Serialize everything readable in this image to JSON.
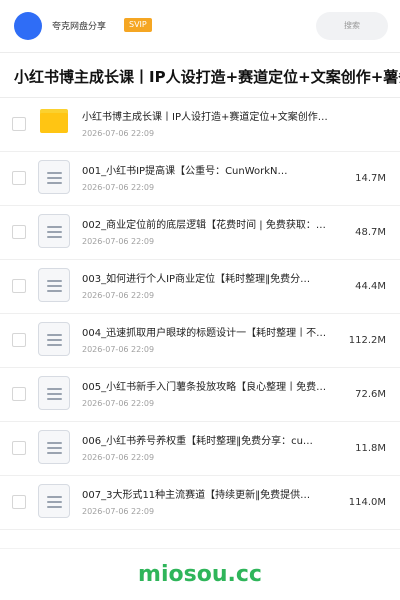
{
  "header": {
    "username": "夸克网盘分享",
    "badge": "SVIP",
    "search_placeholder": "搜索",
    "accent_color": "#2f6df6",
    "badge_color": "#f5a623"
  },
  "folder": {
    "title": "小红书博主成长课丨IP人设打造+赛道定位+文案创作+薯条"
  },
  "items": [
    {
      "type": "folder",
      "icon": "folder-icon",
      "name": "小红书博主成长课丨IP人设打造+赛道定位+文案创作…",
      "date": "2026-07-06 22:09",
      "size": ""
    },
    {
      "type": "file",
      "icon": "document-icon",
      "name": "001_小红书IP提高课【公重号：CunWorkN…",
      "date": "2026-07-06 22:09",
      "size": "14.7M"
    },
    {
      "type": "file",
      "icon": "document-icon",
      "name": "002_商业定位前的底层逻辑【花费时间 | 免费获取：…",
      "date": "2026-07-06 22:09",
      "size": "48.7M"
    },
    {
      "type": "file",
      "icon": "document-icon",
      "name": "003_如何进行个人IP商业定位【耗时整理‖免费分…",
      "date": "2026-07-06 22:09",
      "size": "44.4M"
    },
    {
      "type": "file",
      "icon": "document-icon",
      "name": "004_迅速抓取用户眼球的标题设计一【耗时整理丨不…",
      "date": "2026-07-06 22:09",
      "size": "112.2M"
    },
    {
      "type": "file",
      "icon": "document-icon",
      "name": "005_小红书新手入门薯条投放攻略【良心整理丨免费…",
      "date": "2026-07-06 22:09",
      "size": "72.6M"
    },
    {
      "type": "file",
      "icon": "document-icon",
      "name": "006_小红书养号养权重【耗时整理‖免费分享：cu…",
      "date": "2026-07-06 22:09",
      "size": "11.8M"
    },
    {
      "type": "file",
      "icon": "document-icon",
      "name": "007_3大形式11种主流赛道【持续更新‖免费提供…",
      "date": "2026-07-06 22:09",
      "size": "114.0M"
    }
  ],
  "watermark": "miosou.cc"
}
